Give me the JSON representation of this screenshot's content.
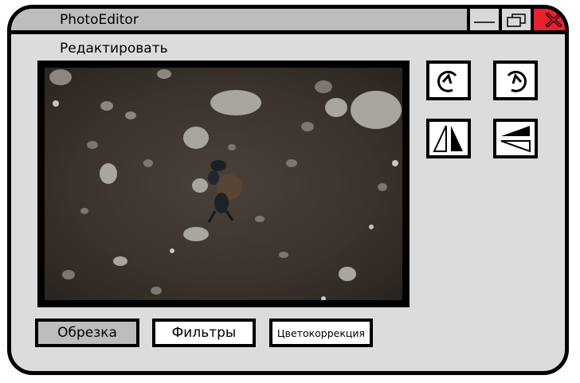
{
  "window": {
    "title": "PhotoEditor"
  },
  "menu": {
    "edit_label": "Редактировать"
  },
  "tools": [
    {
      "name": "rotate-right",
      "icon": "rotate-cw-icon"
    },
    {
      "name": "rotate-left",
      "icon": "rotate-ccw-icon"
    },
    {
      "name": "flip-horizontal",
      "icon": "flip-horizontal-icon"
    },
    {
      "name": "flip-vertical",
      "icon": "flip-vertical-icon"
    }
  ],
  "bottom_buttons": {
    "crop": "Обрезка",
    "filters": "Фильтры",
    "color_correction": "Цветокоррекция"
  },
  "colors": {
    "window_bg": "#dcdcdc",
    "titlebar": "#bdbdbd",
    "close_button": "#e8212f",
    "active_button": "#bdbdbd"
  }
}
